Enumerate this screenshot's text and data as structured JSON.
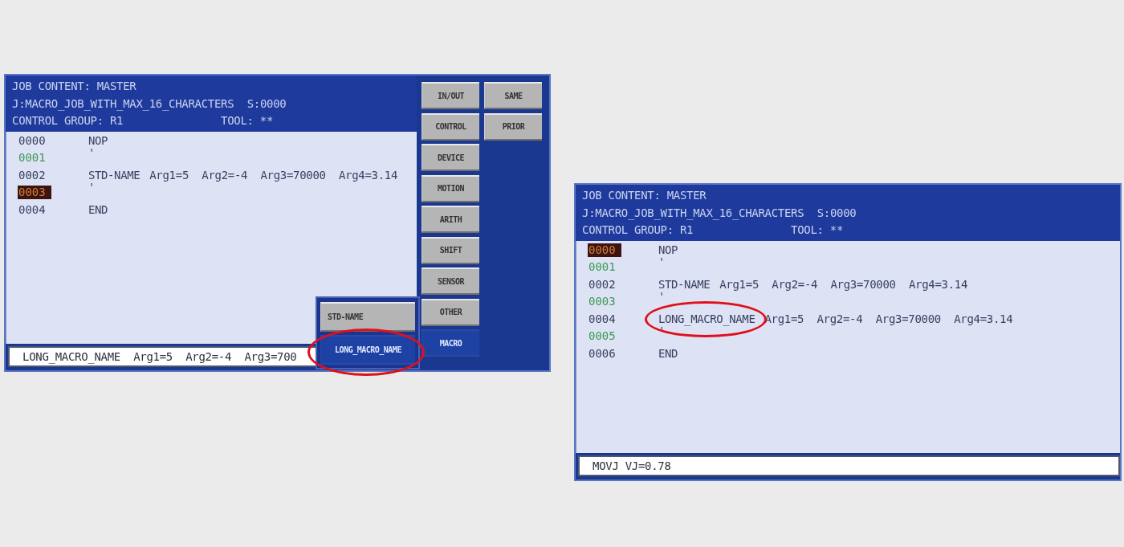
{
  "screens": [
    {
      "header": {
        "title": "JOB CONTENT: MASTER",
        "job": "J:MACRO_JOB_WITH_MAX_16_CHARACTERS",
        "step": "S:0000",
        "group": "CONTROL GROUP: R1",
        "tool": "TOOL: **"
      },
      "lines": [
        {
          "number": "0000",
          "command": "NOP",
          "selected": false,
          "comment": false,
          "circled": false
        },
        {
          "number": "0001",
          "command": "'",
          "selected": false,
          "comment": true,
          "circled": false
        },
        {
          "number": "0002",
          "command": "STD-NAME",
          "args": "Arg1=5  Arg2=-4  Arg3=70000  Arg4=3.14",
          "selected": false,
          "comment": false,
          "circled": false
        },
        {
          "number": "0003",
          "command": "'",
          "selected": true,
          "comment": true,
          "circled": false
        },
        {
          "number": "0004",
          "command": "END",
          "selected": false,
          "comment": false,
          "circled": false
        }
      ],
      "input_line": "LONG_MACRO_NAME  Arg1=5  Arg2=-4  Arg3=700",
      "menu": {
        "items": [
          {
            "label": "IN/OUT",
            "selected": false
          },
          {
            "label": "CONTROL",
            "selected": false
          },
          {
            "label": "DEVICE",
            "selected": false
          },
          {
            "label": "MOTION",
            "selected": false
          },
          {
            "label": "ARITH",
            "selected": false
          },
          {
            "label": "SHIFT",
            "selected": false
          },
          {
            "label": "SENSOR",
            "selected": false
          },
          {
            "label": "OTHER",
            "selected": false
          },
          {
            "label": "MACRO",
            "selected": true
          }
        ],
        "extra_items": [
          {
            "label": "SAME",
            "selected": false
          },
          {
            "label": "PRIOR",
            "selected": false
          }
        ]
      },
      "submenu": {
        "items": [
          {
            "label": "STD-NAME",
            "selected": false,
            "circled": false
          },
          {
            "label": "LONG_MACRO_NAME",
            "selected": true,
            "circled": true
          }
        ]
      }
    },
    {
      "header": {
        "title": "JOB CONTENT: MASTER",
        "job": "J:MACRO_JOB_WITH_MAX_16_CHARACTERS",
        "step": "S:0000",
        "group": "CONTROL GROUP: R1",
        "tool": "TOOL: **"
      },
      "lines": [
        {
          "number": "0000",
          "command": "NOP",
          "selected": true,
          "comment": false,
          "circled": false
        },
        {
          "number": "0001",
          "command": "'",
          "selected": false,
          "comment": true,
          "circled": false
        },
        {
          "number": "0002",
          "command": "STD-NAME",
          "args": "Arg1=5  Arg2=-4  Arg3=70000  Arg4=3.14",
          "selected": false,
          "comment": false,
          "circled": false
        },
        {
          "number": "0003",
          "command": "'",
          "selected": false,
          "comment": true,
          "circled": false
        },
        {
          "number": "0004",
          "command": "LONG_MACRO_NAME",
          "args": "Arg1=5  Arg2=-4  Arg3=70000  Arg4=3.14",
          "selected": false,
          "comment": false,
          "circled": true
        },
        {
          "number": "0005",
          "command": "'",
          "selected": false,
          "comment": true,
          "circled": false
        },
        {
          "number": "0006",
          "command": "END",
          "selected": false,
          "comment": false,
          "circled": false
        }
      ],
      "input_line": "MOVJ VJ=0.78"
    }
  ]
}
